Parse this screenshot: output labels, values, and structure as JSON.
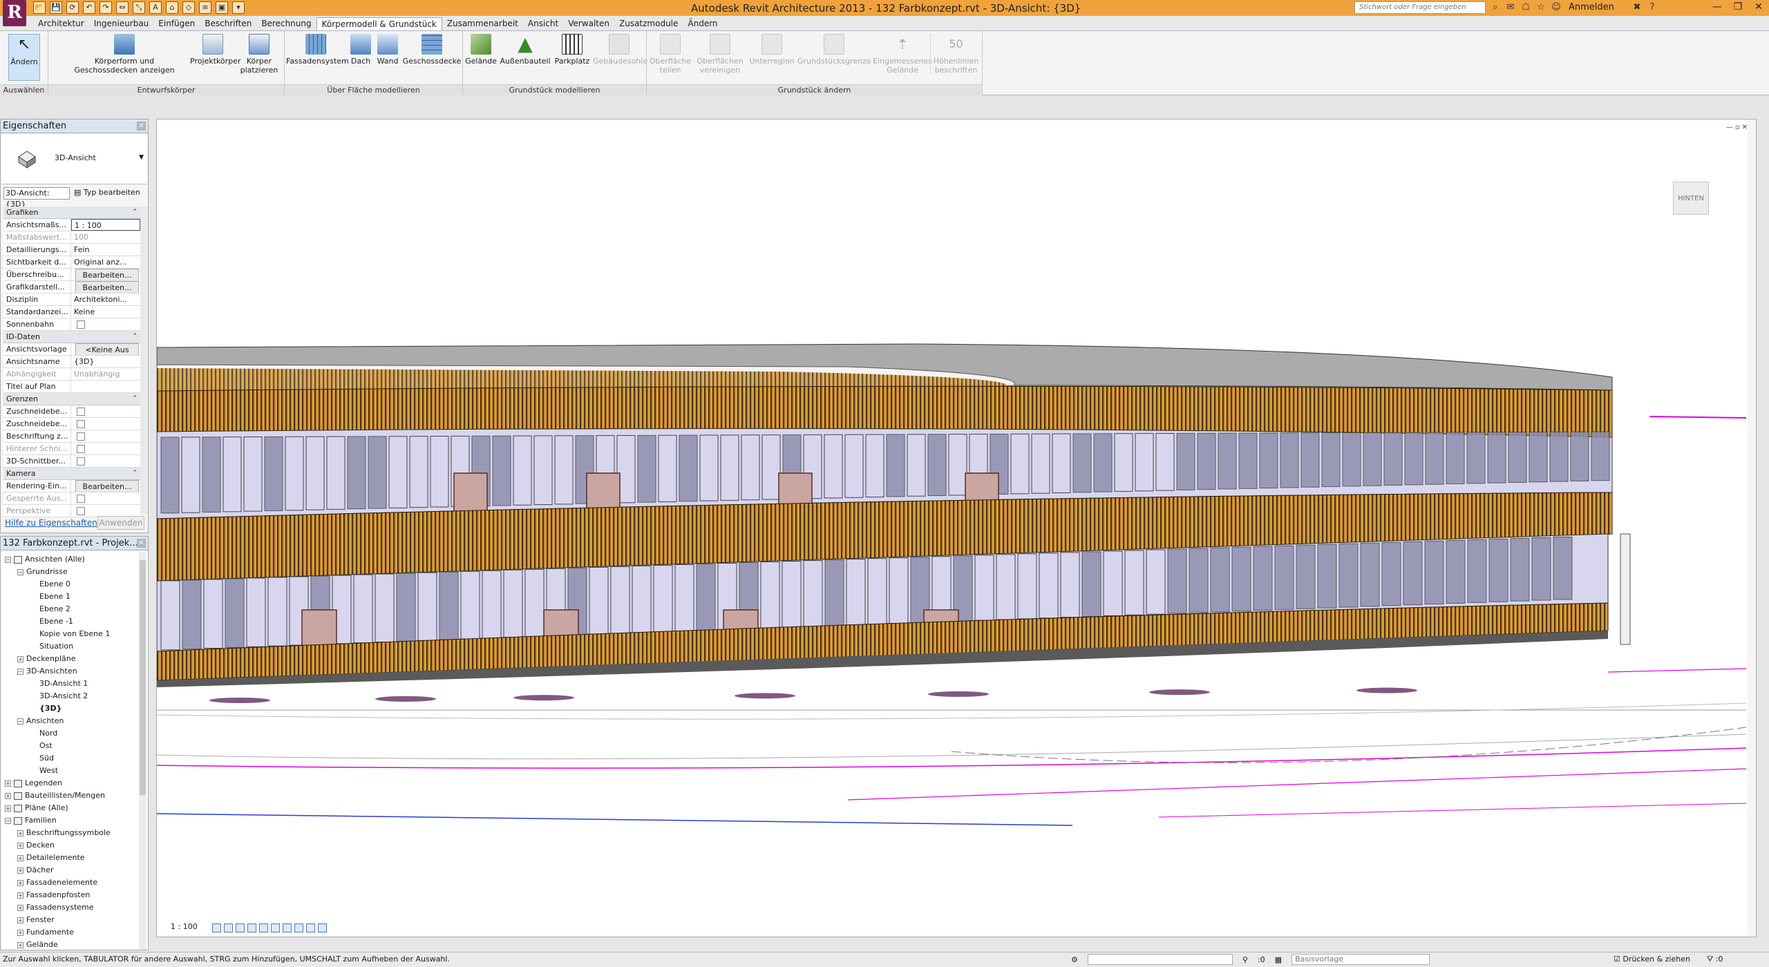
{
  "window": {
    "logo": "R",
    "title": "Autodesk Revit Architecture 2013 -     132 Farbkonzept.rvt - 3D-Ansicht: {3D}",
    "search_placeholder": "Stichwort oder Frage eingeben",
    "login": "Anmelden",
    "qat_icons": [
      "open-icon",
      "save-icon",
      "sync-icon",
      "undo-icon",
      "redo-icon",
      "measure-icon",
      "dimension-icon",
      "text-icon",
      "3d-view-icon",
      "section-icon",
      "thin-lines-icon",
      "close-hidden-icon",
      "switch-windows-icon"
    ],
    "quick_access_glyphs": [
      "📂",
      "💾",
      "⟳",
      "↶",
      "↷",
      "⇔",
      "⤡",
      "A",
      "⌂",
      "◇",
      "≡",
      "▣",
      "▾"
    ]
  },
  "tabs": [
    {
      "label": "Architektur",
      "active": false
    },
    {
      "label": "Ingenieurbau",
      "active": false
    },
    {
      "label": "Einfügen",
      "active": false
    },
    {
      "label": "Beschriften",
      "active": false
    },
    {
      "label": "Berechnung",
      "active": false
    },
    {
      "label": "Körpermodell & Grundstück",
      "active": true
    },
    {
      "label": "Zusammenarbeit",
      "active": false
    },
    {
      "label": "Ansicht",
      "active": false
    },
    {
      "label": "Verwalten",
      "active": false
    },
    {
      "label": "Zusatzmodule",
      "active": false
    },
    {
      "label": "Ändern",
      "active": false
    }
  ],
  "ribbon": {
    "panels": {
      "select": "Auswählen",
      "conceptual": "Entwurfskörper",
      "by_face": "Über Fläche modellieren",
      "site_model": "Grundstück modellieren",
      "modify_site": "Grundstück ändern"
    },
    "buttons": {
      "modify": "Ändern",
      "show_mass": "Körperform und Geschossdecken anzeigen",
      "in_place_mass": "Projektkörper",
      "place_mass": "Körper platzieren",
      "curtain_system": "Fassadensystem",
      "roof": "Dach",
      "wall": "Wand",
      "floor": "Geschossdecke",
      "toposurface": "Gelände",
      "site_component": "Außenbauteil",
      "parking": "Parkplatz",
      "building_pad": "Gebäudesohle",
      "split_surface": "Oberfläche teilen",
      "merge_surfaces": "Oberflächen vereinigen",
      "subregion": "Unterregion",
      "property_line": "Grundstücksgrenze",
      "graded_region": "Eingemessenes Gelände",
      "label_contours": "Höhenlinien beschriften"
    }
  },
  "properties": {
    "title": "Eigenschaften",
    "type_name": "3D-Ansicht",
    "view_filter": "3D-Ansicht: {3D}",
    "edit_type": "Typ bearbeiten",
    "help_link": "Hilfe zu Eigenschaften",
    "apply": "Anwenden",
    "groups": [
      {
        "name": "Grafiken",
        "rows": [
          {
            "k": "Ansichtsmaßs...",
            "v": "1 : 100",
            "kind": "input"
          },
          {
            "k": "Maßstabswert...",
            "v": "100",
            "kind": "dim"
          },
          {
            "k": "Detaillierungs...",
            "v": "Fein",
            "kind": "text"
          },
          {
            "k": "Sichtbarkeit d...",
            "v": "Original anz...",
            "kind": "text"
          },
          {
            "k": "Überschreibu...",
            "v": "Bearbeiten...",
            "kind": "button"
          },
          {
            "k": "Grafikdarstell...",
            "v": "Bearbeiten...",
            "kind": "button"
          },
          {
            "k": "Disziplin",
            "v": "Architektoni...",
            "kind": "text"
          },
          {
            "k": "Standardanzei...",
            "v": "Keine",
            "kind": "text"
          },
          {
            "k": "Sonnenbahn",
            "v": "",
            "kind": "check"
          }
        ]
      },
      {
        "name": "ID-Daten",
        "rows": [
          {
            "k": "Ansichtsvorlage",
            "v": "<Keine Aus",
            "kind": "button"
          },
          {
            "k": "Ansichtsname",
            "v": "{3D}",
            "kind": "text"
          },
          {
            "k": "Abhängigkeit",
            "v": "Unabhängig",
            "kind": "dim"
          },
          {
            "k": "Titel auf Plan",
            "v": "",
            "kind": "text"
          }
        ]
      },
      {
        "name": "Grenzen",
        "rows": [
          {
            "k": "Zuschneidebe...",
            "v": "",
            "kind": "check"
          },
          {
            "k": "Zuschneidebe...",
            "v": "",
            "kind": "check"
          },
          {
            "k": "Beschriftung z...",
            "v": "",
            "kind": "check"
          },
          {
            "k": "Hinterer Schni...",
            "v": "",
            "kind": "dimcheck"
          },
          {
            "k": "3D-Schnittber...",
            "v": "",
            "kind": "check"
          }
        ]
      },
      {
        "name": "Kamera",
        "rows": [
          {
            "k": "Rendering-Ein...",
            "v": "Bearbeiten...",
            "kind": "button"
          },
          {
            "k": "Gesperrte Aus...",
            "v": "",
            "kind": "dimcheck"
          },
          {
            "k": "Perspektive",
            "v": "",
            "kind": "dimcheck"
          }
        ]
      }
    ]
  },
  "browser": {
    "title": "132 Farbkonzept.rvt - Projek...",
    "nodes": [
      {
        "label": "Ansichten (Alle)",
        "depth": 0,
        "toggle": "-",
        "icon": true
      },
      {
        "label": "Grundrisse",
        "depth": 1,
        "toggle": "-"
      },
      {
        "label": "Ebene 0",
        "depth": 2
      },
      {
        "label": "Ebene 1",
        "depth": 2
      },
      {
        "label": "Ebene 2",
        "depth": 2
      },
      {
        "label": "Ebene -1",
        "depth": 2
      },
      {
        "label": "Kopie von Ebene 1",
        "depth": 2
      },
      {
        "label": "Situation",
        "depth": 2
      },
      {
        "label": "Deckenpläne",
        "depth": 1,
        "toggle": "+"
      },
      {
        "label": "3D-Ansichten",
        "depth": 1,
        "toggle": "-"
      },
      {
        "label": "3D-Ansicht 1",
        "depth": 2
      },
      {
        "label": "3D-Ansicht 2",
        "depth": 2
      },
      {
        "label": "{3D}",
        "depth": 2,
        "bold": true
      },
      {
        "label": "Ansichten",
        "depth": 1,
        "toggle": "-"
      },
      {
        "label": "Nord",
        "depth": 2
      },
      {
        "label": "Ost",
        "depth": 2
      },
      {
        "label": "Süd",
        "depth": 2
      },
      {
        "label": "West",
        "depth": 2
      },
      {
        "label": "Legenden",
        "depth": 0,
        "toggle": "+",
        "icon": true
      },
      {
        "label": "Bauteillisten/Mengen",
        "depth": 0,
        "toggle": "+",
        "icon": true
      },
      {
        "label": "Pläne (Alle)",
        "depth": 0,
        "toggle": "+",
        "icon": true
      },
      {
        "label": "Familien",
        "depth": 0,
        "toggle": "-",
        "icon": true
      },
      {
        "label": "Beschriftungssymbole",
        "depth": 1,
        "toggle": "+"
      },
      {
        "label": "Decken",
        "depth": 1,
        "toggle": "+"
      },
      {
        "label": "Detailelemente",
        "depth": 1,
        "toggle": "+"
      },
      {
        "label": "Dächer",
        "depth": 1,
        "toggle": "+"
      },
      {
        "label": "Fassadenelemente",
        "depth": 1,
        "toggle": "+"
      },
      {
        "label": "Fassadenpfosten",
        "depth": 1,
        "toggle": "+"
      },
      {
        "label": "Fassadensysteme",
        "depth": 1,
        "toggle": "+"
      },
      {
        "label": "Fenster",
        "depth": 1,
        "toggle": "+"
      },
      {
        "label": "Fundamente",
        "depth": 1,
        "toggle": "+"
      },
      {
        "label": "Gelände",
        "depth": 1,
        "toggle": "+"
      }
    ]
  },
  "viewport": {
    "scale": "1 : 100",
    "viewcube_face": "HINTEN",
    "controls": [
      "—",
      "▫",
      "✕"
    ]
  },
  "status": {
    "text": "Zur Auswahl klicken, TABULATOR für andere Auswahl, STRG zum Hinzufügen, UMSCHALT zum Aufheben der Auswahl.",
    "coord": ":0",
    "workset": "Basisvorlage",
    "drag": "Drücken & ziehen",
    "filter": ":0"
  },
  "colors": {
    "titlebar": "#f0a23c",
    "louver_dark": "#4a3412",
    "louver_light": "#c98a2c",
    "glass": "#d8d6ef",
    "glass_dark": "#8f8fae",
    "door": "#c9a6a1",
    "magenta": "#e000e0",
    "blue_line": "#2a3ccf"
  }
}
